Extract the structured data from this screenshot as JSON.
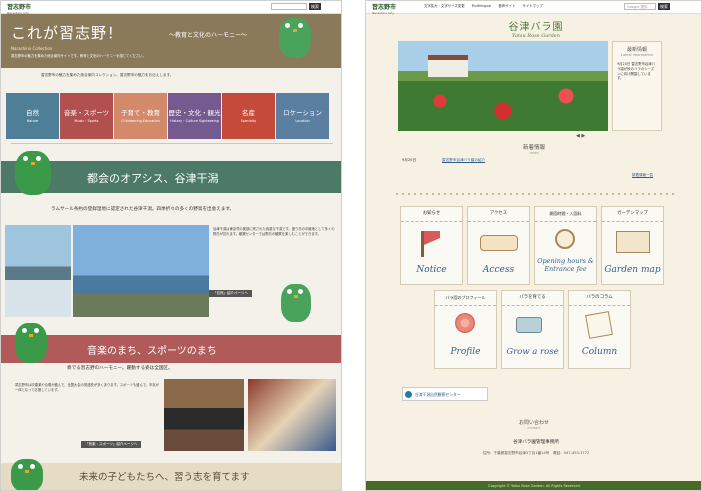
{
  "left": {
    "logo": {
      "jp": "習志野市",
      "en": "Narashino City"
    },
    "search_button": "検索",
    "hero": {
      "title": "これが習志野！",
      "subtitle": "〜教育と文化のハーモニー〜",
      "en": "Narashino Collection",
      "text": "習志野市の魅力を集めた総合案内サイトです。教育と文化のハーモニーを感じてください。"
    },
    "intro": "習志野市の魅力を集めた総合案内コレクション。習志野市の魅力をお伝えします。",
    "categories": [
      {
        "jp": "自然",
        "en": "Nature",
        "color": "#4f7f97"
      },
      {
        "jp": "音楽・スポーツ",
        "en": "Music・Sports",
        "color": "#b25050"
      },
      {
        "jp": "子育て・教育",
        "en": "Childrearing Education",
        "color": "#d28a6a"
      },
      {
        "jp": "歴史・文化・観光",
        "en": "History・Culture Sightseeing",
        "color": "#755a8f"
      },
      {
        "jp": "名産",
        "en": "Specialty",
        "color": "#c54a3a"
      },
      {
        "jp": "ロケーション",
        "en": "Location",
        "color": "#5a7fa0"
      }
    ],
    "section1": {
      "title": "都会のオアシス、谷津干潟",
      "lead": "ラムサール条約の登録湿地に認定された谷津干潟。四季折々の多くの野鳥を出会えます。",
      "text": "谷津干潟は東京湾の奥部に残された貴重な干潟です。渡り鳥の中継地として多くの野鳥が訪れます。観察センターでは野鳥の観察を楽しむことができます。",
      "link": "「自然」紹介ページへ"
    },
    "section2": {
      "title": "音楽のまち、スポーツのまち",
      "lead": "奏でる習志野のハーモニー。躍動する姿は全国区。",
      "text": "習志野市は吹奏楽や合唱が盛んで、全国大会の常連校が多くあります。スポーツも盛んで、市民が一体となって応援しています。",
      "link": "「音楽・スポーツ」紹介ページへ"
    },
    "section3": {
      "title": "未来の子どもたちへ、習う志を育てます"
    }
  },
  "right": {
    "logo": {
      "jp": "習志野市",
      "en": "Narashino City"
    },
    "nav": [
      "文字拡大・文字サイズ変更",
      "Multilingual",
      "音声サイト",
      "サイトマップ"
    ],
    "search_placeholder": "Google 提供",
    "search_button": "検索",
    "title_jp": "谷津バラ園",
    "title_en": "Yatsu Rose Garden",
    "latest": {
      "jp": "最新情報",
      "en": "Latest information",
      "text": "9月20日 習志野市谷津バラ園が秋のバラのシーズンに向け開園しています。"
    },
    "news": {
      "jp": "新着情報",
      "en": "news",
      "items": [
        {
          "date": "9月20日",
          "text": "習志野市谷津バラ園の紹介"
        }
      ],
      "more": "新着情報一覧"
    },
    "tiles": [
      {
        "jp": "お知らせ",
        "en": "Notice"
      },
      {
        "jp": "アクセス",
        "en": "Access"
      },
      {
        "jp": "開園時間・入園料",
        "en": "Opening hours & Entrance fee"
      },
      {
        "jp": "ガーデンマップ",
        "en": "Garden map"
      },
      {
        "jp": "バラ園のプロフィール",
        "en": "Profile"
      },
      {
        "jp": "バラを育てる",
        "en": "Grow a rose"
      },
      {
        "jp": "バラのコラム",
        "en": "Column"
      }
    ],
    "banner": "谷津干潟自然観察センター",
    "contact": {
      "jp": "お問い合わせ",
      "en": "contact",
      "name": "谷津バラ園管理事務所",
      "address": "住所：千葉県習志野市谷津3丁目1番14号　電話：047-453-3772"
    },
    "footer": "Copyright © Yatsu Rose Garden. All Rights Reserved."
  }
}
